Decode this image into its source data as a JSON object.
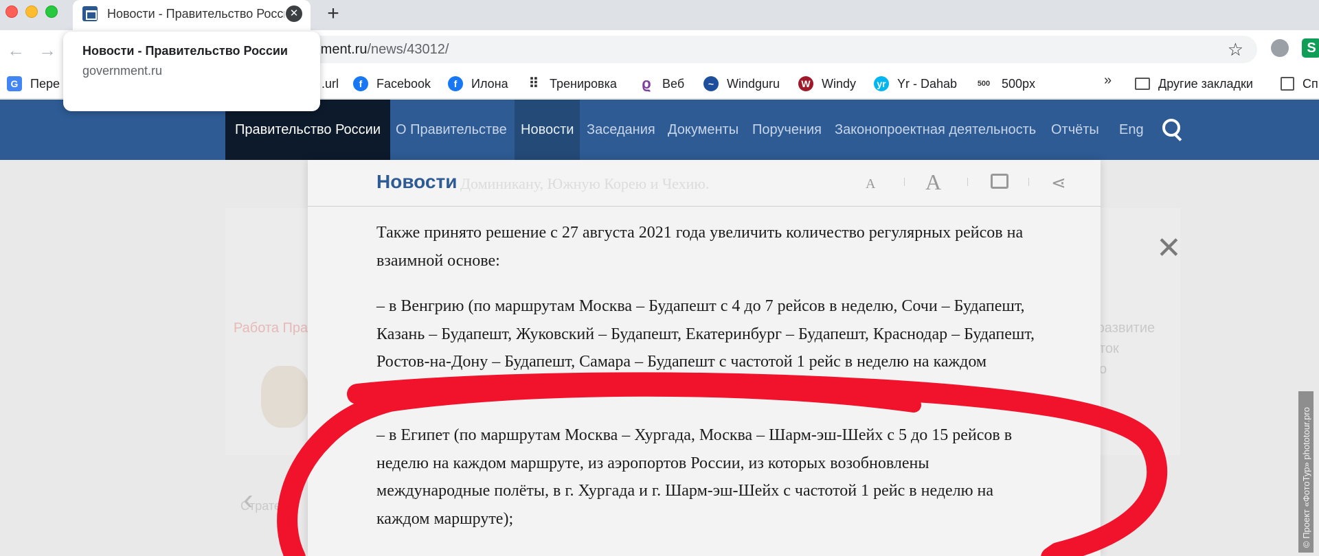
{
  "browser": {
    "tab_title": "Новости - Правительство России",
    "tab_close": "✕",
    "new_tab": "+",
    "back": "←",
    "forward": "→",
    "url_partial": "mment.ru",
    "url_path": "/news/43012/",
    "bookmarks": [
      {
        "label": "Пере",
        "icon": "google-translate-icon"
      },
      {
        "label": ".url",
        "icon": "bookmark-icon"
      },
      {
        "label": "Facebook",
        "icon": "facebook-icon"
      },
      {
        "label": "Илона",
        "icon": "facebook-icon"
      },
      {
        "label": "Тренировка",
        "icon": "grid-icon"
      },
      {
        "label": "Веб",
        "icon": "veb-icon"
      },
      {
        "label": "Windguru",
        "icon": "windguru-icon"
      },
      {
        "label": "Windy",
        "icon": "windy-icon"
      },
      {
        "label": "Yr - Dahab",
        "icon": "yr-icon"
      },
      {
        "label": "500px",
        "icon": "500px-icon"
      },
      {
        "label": "Другие закладки",
        "icon": "folder-icon"
      },
      {
        "label": "Сп",
        "icon": "reading-list-icon"
      }
    ],
    "bookmarks_more": "»"
  },
  "tooltip": {
    "title": "Новости - Правительство России",
    "domain": "government.ru"
  },
  "nav": {
    "home": "Правительство России",
    "items": [
      "О Правительстве",
      "Новости",
      "Заседания",
      "Документы",
      "Поручения",
      "Законопроектная деятельность",
      "Отчёты",
      "Eng"
    ],
    "active_index": 1
  },
  "background": {
    "link": "Работа Пра",
    "side_lines": [
      "е развитие",
      "сток",
      "о"
    ],
    "strategy": "Страте",
    "left_arrow": "‹",
    "right_arrow": "›",
    "close": "✕",
    "watermark": "© Проект «ФотоТур» phototour.pro"
  },
  "modal": {
    "section_title": "Новости",
    "ghost_text": "Доминикану, Южную Корею и Чехию.",
    "font_small": "A",
    "font_large": "A",
    "share": "⋖",
    "paragraphs": [
      "Также принято решение с 27 августа 2021 года увеличить количество регулярных рейсов на взаимной основе:",
      "– в Венгрию (по маршрутам Москва – Будапешт с 4 до 7 рейсов в неделю, Сочи – Будапешт, Казань – Будапешт, Жуковский – Будапешт, Екатеринбург – Будапешт, Краснодар – Будапешт, Ростов-на-Дону – Будапешт, Самара – Будапешт с частотой 1 рейс в неделю на каждом маршруте);",
      "– в Египет (по маршрутам Москва – Хургада, Москва – Шарм-эш-Шейх с 5 до 15 рейсов в неделю на каждом маршруте, из аэропортов России, из которых возобновлены международные полёты, в г. Хургада и г. Шарм-эш-Шейх с частотой 1 рейс в неделю на каждом маршруте);"
    ]
  },
  "colors": {
    "nav_bg": "#2e5b94",
    "nav_home_bg": "#0c1a2c",
    "marker": "#f0132b"
  }
}
